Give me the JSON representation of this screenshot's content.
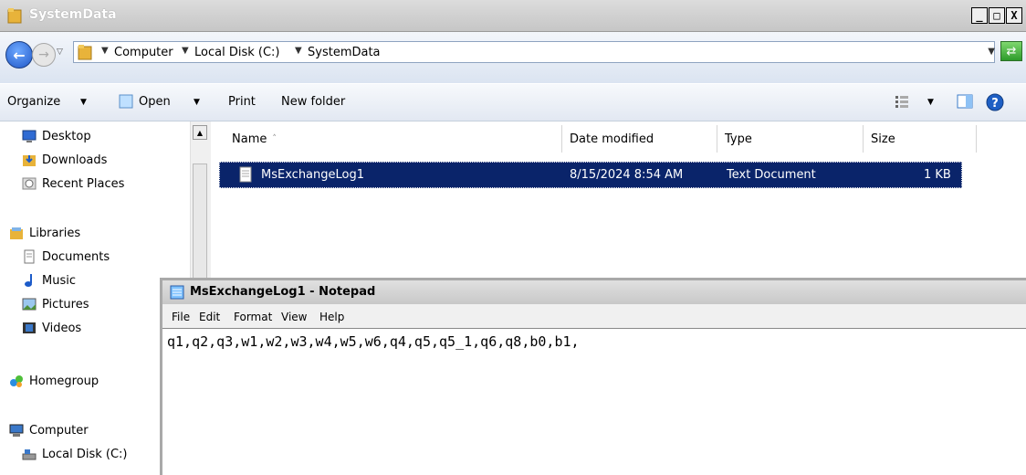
{
  "window": {
    "title": "SystemData",
    "controls": {
      "minimize": "_",
      "maximize": "□",
      "close": "X"
    }
  },
  "address": {
    "crumbs": [
      "Computer",
      "Local Disk (C:)",
      "SystemData"
    ]
  },
  "toolbar": {
    "organize": "Organize",
    "open": "Open",
    "print": "Print",
    "new_folder": "New folder"
  },
  "nav": {
    "desktop": "Desktop",
    "downloads": "Downloads",
    "recent_places": "Recent Places",
    "libraries": "Libraries",
    "documents": "Documents",
    "music": "Music",
    "pictures": "Pictures",
    "videos": "Videos",
    "homegroup": "Homegroup",
    "computer": "Computer",
    "local_disk": "Local Disk (C:)"
  },
  "columns": {
    "name": "Name",
    "date_modified": "Date modified",
    "type": "Type",
    "size": "Size"
  },
  "files": [
    {
      "name": "MsExchangeLog1",
      "date": "8/15/2024 8:54 AM",
      "type": "Text Document",
      "size": "1 KB"
    }
  ],
  "notepad": {
    "title": "MsExchangeLog1 - Notepad",
    "menu": [
      "File",
      "Edit",
      "Format",
      "View",
      "Help"
    ],
    "content": "q1,q2,q3,w1,w2,w3,w4,w5,w6,q4,q5,q5_1,q6,q8,b0,b1,"
  },
  "colors": {
    "selection": "#0a246a",
    "folder": "#e8b33a"
  }
}
